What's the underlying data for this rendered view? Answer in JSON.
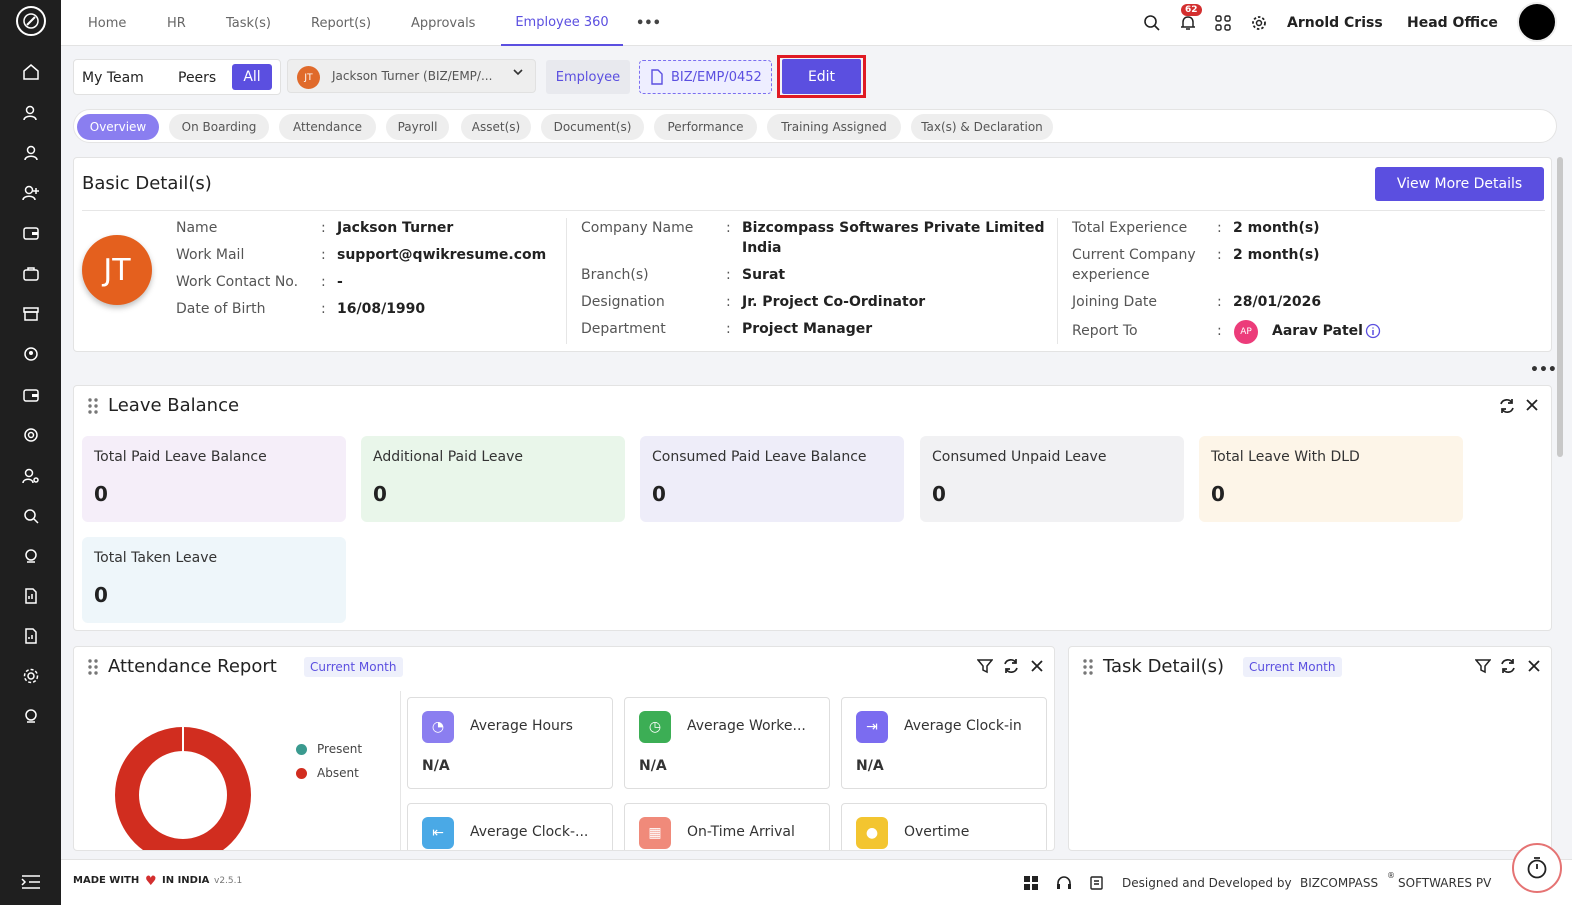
{
  "topnav": {
    "items": [
      "Home",
      "HR",
      "Task(s)",
      "Report(s)",
      "Approvals",
      "Employee 360"
    ],
    "more": "•••",
    "notif_count": "62",
    "user_name": "Arnold Criss",
    "office": "Head Office"
  },
  "toolbar": {
    "my_team": "My Team",
    "peers": "Peers",
    "all": "All",
    "emp_initials": "JT",
    "emp_select": "Jackson Turner (BIZ/EMP/...",
    "employee_tag": "Employee",
    "emp_code": "BIZ/EMP/0452",
    "edit": "Edit"
  },
  "tabs": [
    "Overview",
    "On Boarding",
    "Attendance",
    "Payroll",
    "Asset(s)",
    "Document(s)",
    "Performance",
    "Training Assigned",
    "Tax(s) & Declaration"
  ],
  "basic": {
    "title": "Basic Detail(s)",
    "view_more": "View More Details",
    "initials": "JT",
    "col1": {
      "name_l": "Name",
      "name_v": "Jackson Turner",
      "mail_l": "Work Mail",
      "mail_v": "support@qwikresume.com",
      "contact_l": "Work Contact No.",
      "contact_v": "-",
      "dob_l": "Date of Birth",
      "dob_v": "16/08/1990"
    },
    "col2": {
      "company_l": "Company Name",
      "company_v1": "Bizcompass Softwares Private Limited",
      "company_v2": "India",
      "branch_l": "Branch(s)",
      "branch_v": "Surat",
      "desig_l": "Designation",
      "desig_v": "Jr. Project Co-Ordinator",
      "dept_l": "Department",
      "dept_v": "Project Manager"
    },
    "col3": {
      "exp_l": "Total Experience",
      "exp_v": "2 month(s)",
      "cexp_l1": "Current Company",
      "cexp_l2": "experience",
      "cexp_v": "2 month(s)",
      "join_l": "Joining Date",
      "join_v": "28/01/2026",
      "report_l": "Report To",
      "report_initials": "AP",
      "report_v": "Aarav Patel"
    }
  },
  "leave": {
    "title": "Leave Balance",
    "cards": [
      {
        "label": "Total Paid Leave Balance",
        "value": "0"
      },
      {
        "label": "Additional Paid Leave",
        "value": "0"
      },
      {
        "label": "Consumed Paid Leave Balance",
        "value": "0"
      },
      {
        "label": "Consumed Unpaid Leave",
        "value": "0"
      },
      {
        "label": "Total Leave With DLD",
        "value": "0"
      },
      {
        "label": "Total Taken Leave",
        "value": "0"
      }
    ],
    "colors": [
      "#f5eef9",
      "#e9f6ea",
      "#eeedf9",
      "#f1f1f3",
      "#fdf5e8",
      "#eef6fa"
    ]
  },
  "attendance": {
    "title": "Attendance Report",
    "period": "Current Month",
    "legend": [
      "Present",
      "Absent"
    ],
    "legend_colors": [
      "#3a9a8f",
      "#d12d1f"
    ],
    "stats": [
      {
        "label": "Average Hours",
        "value": "N/A",
        "color": "#8b7ef0"
      },
      {
        "label": "Average Worke...",
        "value": "N/A",
        "color": "#3cae55"
      },
      {
        "label": "Average Clock-in",
        "value": "N/A",
        "color": "#7b6cf0"
      },
      {
        "label": "Average Clock-...",
        "value": "",
        "color": "#4aa9e6"
      },
      {
        "label": "On-Time Arrival",
        "value": "",
        "color": "#f08a7a"
      },
      {
        "label": "Overtime",
        "value": "",
        "color": "#f3c530"
      }
    ]
  },
  "task": {
    "title": "Task Detail(s)",
    "period": "Current Month"
  },
  "footer": {
    "made_with": "MADE WITH",
    "in_india": "IN INDIA",
    "version": "v2.5.1",
    "designed": "Designed and Developed by",
    "brand": "BIZCOMPASS",
    "brand_rest": "SOFTWARES PV"
  }
}
